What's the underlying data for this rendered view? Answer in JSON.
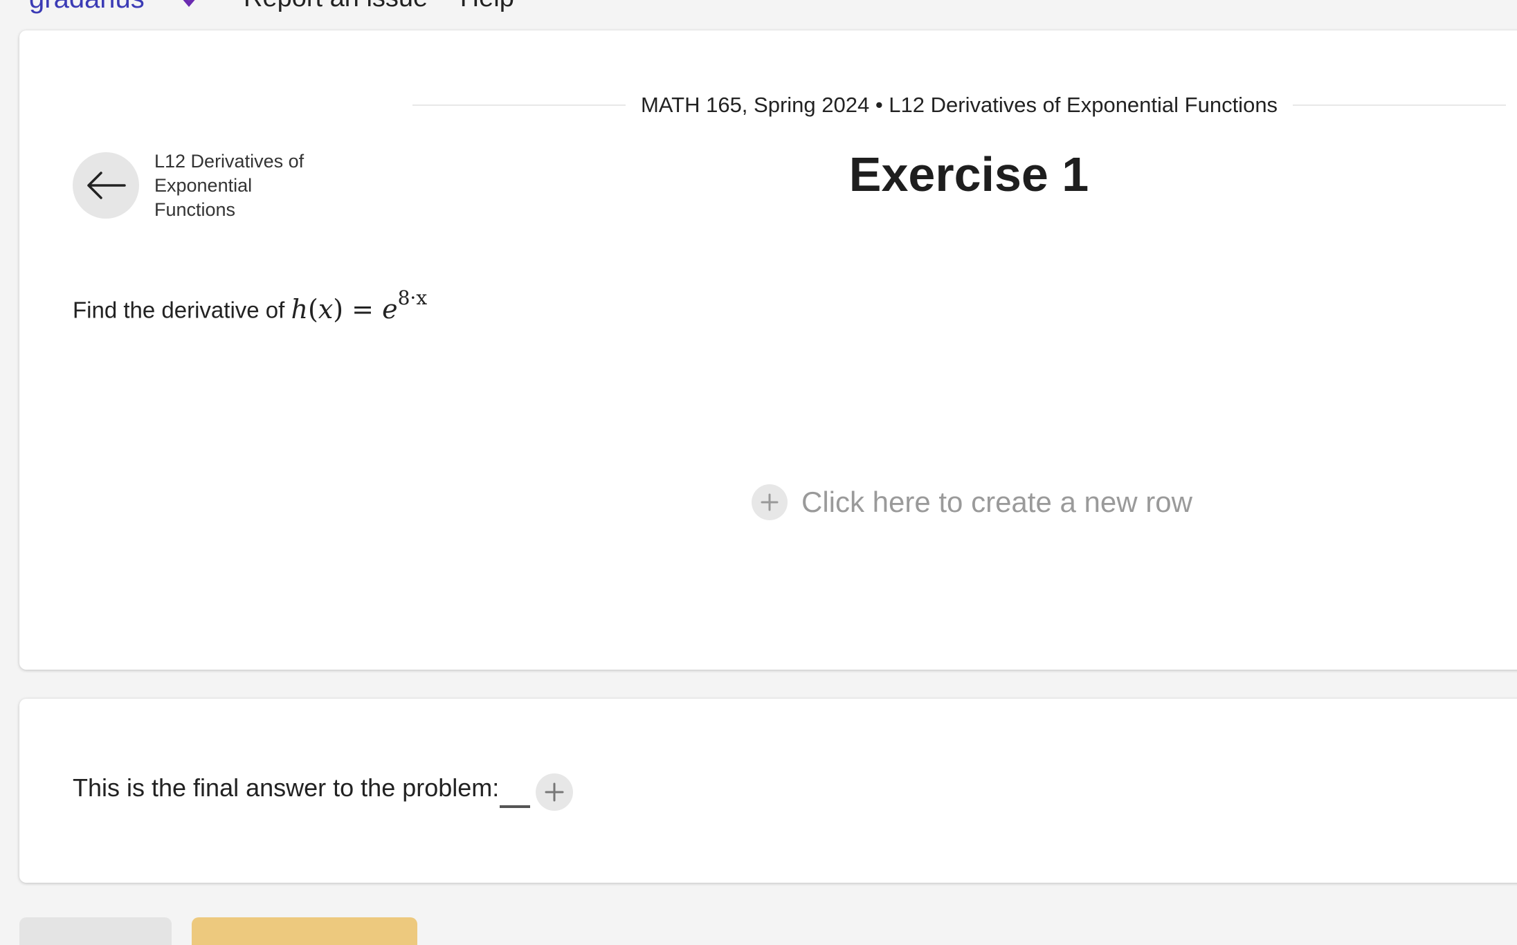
{
  "topbar": {
    "brand": "gradarius",
    "nav": [
      "Report an issue",
      "Help"
    ]
  },
  "course": {
    "line": "MATH 165, Spring 2024 • L12 Derivatives of Exponential Functions"
  },
  "exercise": {
    "title": "Exercise 1"
  },
  "back": {
    "label": "L12 Derivatives of Exponential Functions"
  },
  "problem": {
    "prompt": "Find the derivative of",
    "fn": "h",
    "var": "x",
    "equals": "=",
    "base": "e",
    "exponent": "8·x"
  },
  "workspace": {
    "new_row": "Click here to create a new row"
  },
  "final": {
    "label": "This is the final answer to the problem:"
  },
  "colors": {
    "brand": "#3b3bb5",
    "accent_button": "#edc97e"
  }
}
